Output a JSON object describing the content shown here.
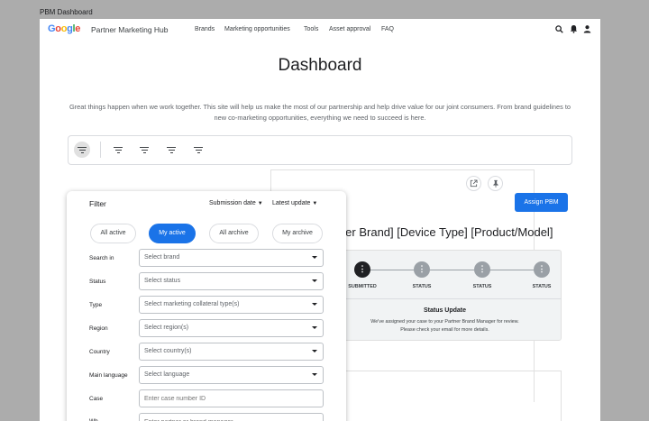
{
  "window": {
    "title": "PBM Dashboard"
  },
  "nav": {
    "brand": "Partner Marketing Hub",
    "items": [
      "Brands",
      "Marketing opportunities",
      "Tools",
      "Asset approval",
      "FAQ"
    ]
  },
  "page": {
    "title": "Dashboard",
    "intro": "Great things happen when we work together. This site will help us make the most of our partnership and help drive value for our joint consumers. From brand guidelines to new co-marketing opportunities, everything we need to succeed is here."
  },
  "filter_panel": {
    "title": "Filter",
    "sort_by": "Submission date",
    "order": "Latest update",
    "chips": [
      "All active",
      "My active",
      "All archive",
      "My archive"
    ],
    "selected_chip": "My active",
    "fields": [
      {
        "label": "Search in",
        "placeholder": "Select brand",
        "kind": "select"
      },
      {
        "label": "Status",
        "placeholder": "Select status",
        "kind": "select"
      },
      {
        "label": "Type",
        "placeholder": "Select marketing collateral type(s)",
        "kind": "select"
      },
      {
        "label": "Region",
        "placeholder": "Select region(s)",
        "kind": "select"
      },
      {
        "label": "Country",
        "placeholder": "Select country(s)",
        "kind": "select"
      },
      {
        "label": "Main language",
        "placeholder": "Select language",
        "kind": "select"
      },
      {
        "label": "Case",
        "placeholder": "Enter case number ID",
        "kind": "input"
      },
      {
        "label": "Wh",
        "placeholder": "Enter partner or brand manager",
        "kind": "input"
      }
    ]
  },
  "case": {
    "title": "rtner Brand] [Device Type] [Product/Model]",
    "assign_button": "Assign PBM",
    "steps": [
      "SUBMITTED",
      "STATUS",
      "STATUS",
      "STATUS"
    ],
    "current_step": 1,
    "status_update": {
      "title": "Status Update",
      "line1": "We've assigned your case to your Partner Brand Manager for review.",
      "line2": "Please check your email for more details."
    }
  },
  "colors": {
    "primary": "#1a73e8",
    "step_done": "#202124",
    "step_pending": "#9aa0a6"
  },
  "icons": [
    "search-icon",
    "bell-icon",
    "account-icon",
    "filter-icon",
    "open-in-new-icon",
    "pin-icon",
    "dropdown-caret-icon",
    "more-vert-icon"
  ]
}
